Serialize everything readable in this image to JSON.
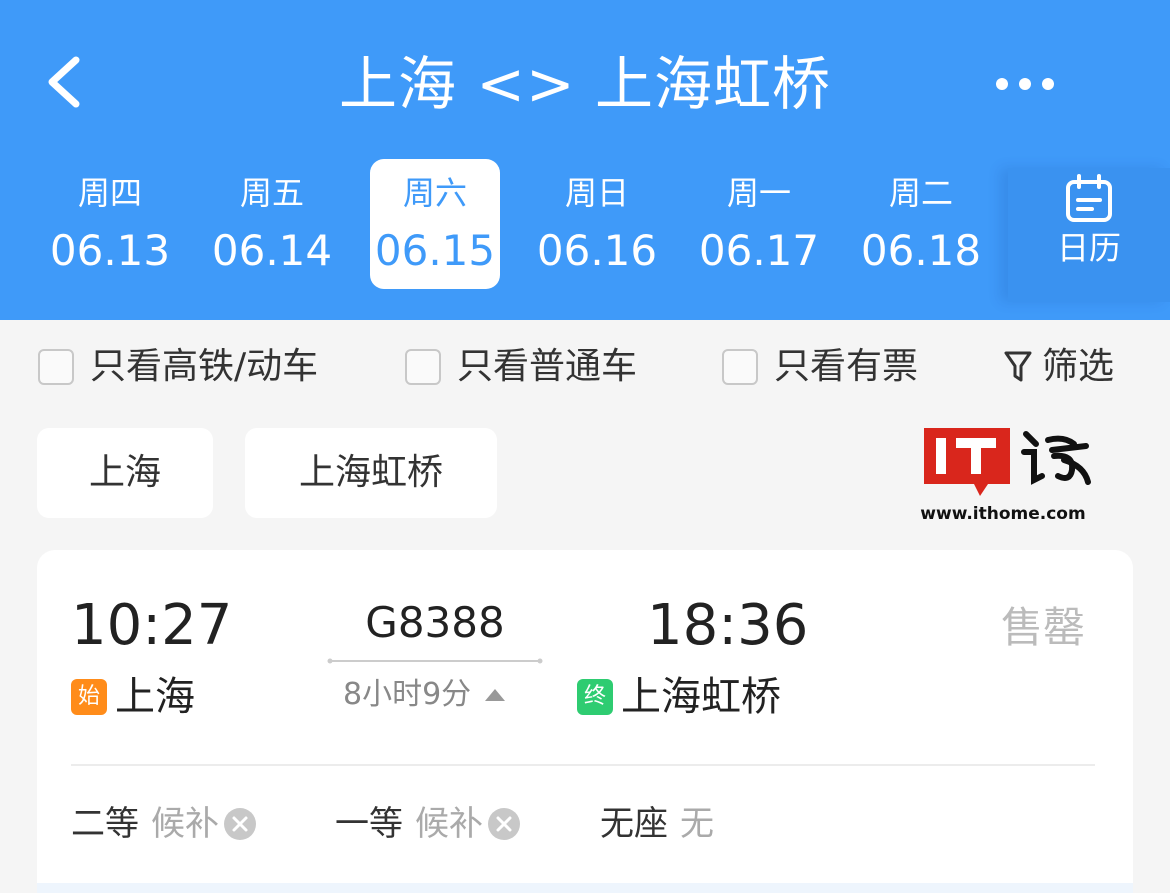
{
  "header": {
    "title": "上海 <> 上海虹桥",
    "dates": [
      {
        "weekday": "周四",
        "date": "06.13",
        "active": false
      },
      {
        "weekday": "周五",
        "date": "06.14",
        "active": false
      },
      {
        "weekday": "周六",
        "date": "06.15",
        "active": true
      },
      {
        "weekday": "周日",
        "date": "06.16",
        "active": false
      },
      {
        "weekday": "周一",
        "date": "06.17",
        "active": false
      },
      {
        "weekday": "周二",
        "date": "06.18",
        "active": false
      }
    ],
    "calendar_label": "日历"
  },
  "filters": {
    "high_speed_only": "只看高铁/动车",
    "regular_only": "只看普通车",
    "available_only": "只看有票",
    "filter_label": "筛选"
  },
  "stations": [
    "上海",
    "上海虹桥"
  ],
  "watermark": {
    "logo_text": "IT之家",
    "url": "www.ithome.com"
  },
  "train": {
    "departure_time": "10:27",
    "arrival_time": "18:36",
    "number": "G8388",
    "duration": "8小时9分",
    "start_tag": "始",
    "end_tag": "终",
    "from_station": "上海",
    "to_station": "上海虹桥",
    "status": "售罄",
    "seats": [
      {
        "class": "二等",
        "availability": "候补"
      },
      {
        "class": "一等",
        "availability": "候补"
      },
      {
        "class": "无座",
        "availability": "无"
      }
    ]
  },
  "colors": {
    "primary": "#3f9af9",
    "start_tag": "#ff8c1a",
    "end_tag": "#2ecc71"
  },
  "icons": [
    "back-arrow-icon",
    "more-dots-icon",
    "calendar-icon",
    "filter-funnel-icon",
    "expand-up-triangle-icon",
    "clear-circle-icon"
  ]
}
